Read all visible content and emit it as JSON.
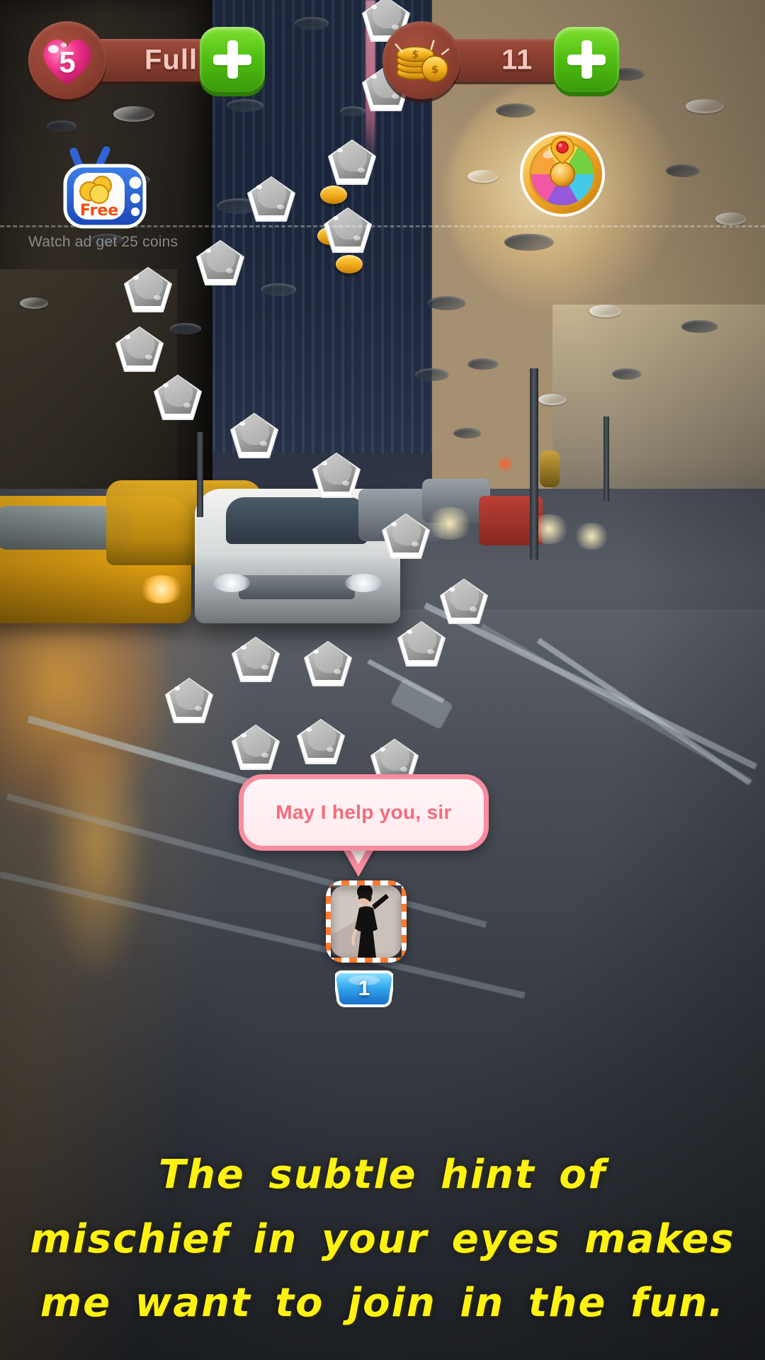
{
  "hud": {
    "lives": {
      "icon": "heart-icon",
      "value": "5",
      "label": "Full",
      "add_label": "+"
    },
    "coins": {
      "icon": "coin-stack-icon",
      "value": "11",
      "add_label": "+"
    }
  },
  "free_reward": {
    "icon": "tv-icon",
    "label": "Free",
    "hint": "Watch ad get 25 coins"
  },
  "spin_wheel": {
    "icon": "fortune-wheel-icon"
  },
  "character": {
    "avatar": "female-avatar",
    "level_badge": "1",
    "speech": "May I help you, sir"
  },
  "subtitle": {
    "line1": "The  subtle  hint  of",
    "line2": "mischief  in  your  eyes  makes",
    "line3": "me  want  to  join  in  the  fun."
  },
  "colors": {
    "hud_bar": "#8b3f31",
    "plus_green": "#4fbd12",
    "heart_pink": "#f0348a",
    "coin_gold": "#f2b01a",
    "bubble_border": "#f98ca0",
    "bubble_text": "#f46b7c",
    "subtitle_yellow": "#fff212",
    "free_label": "#f24d14"
  },
  "path": {
    "stone_count": 22,
    "coin_count": 3
  }
}
